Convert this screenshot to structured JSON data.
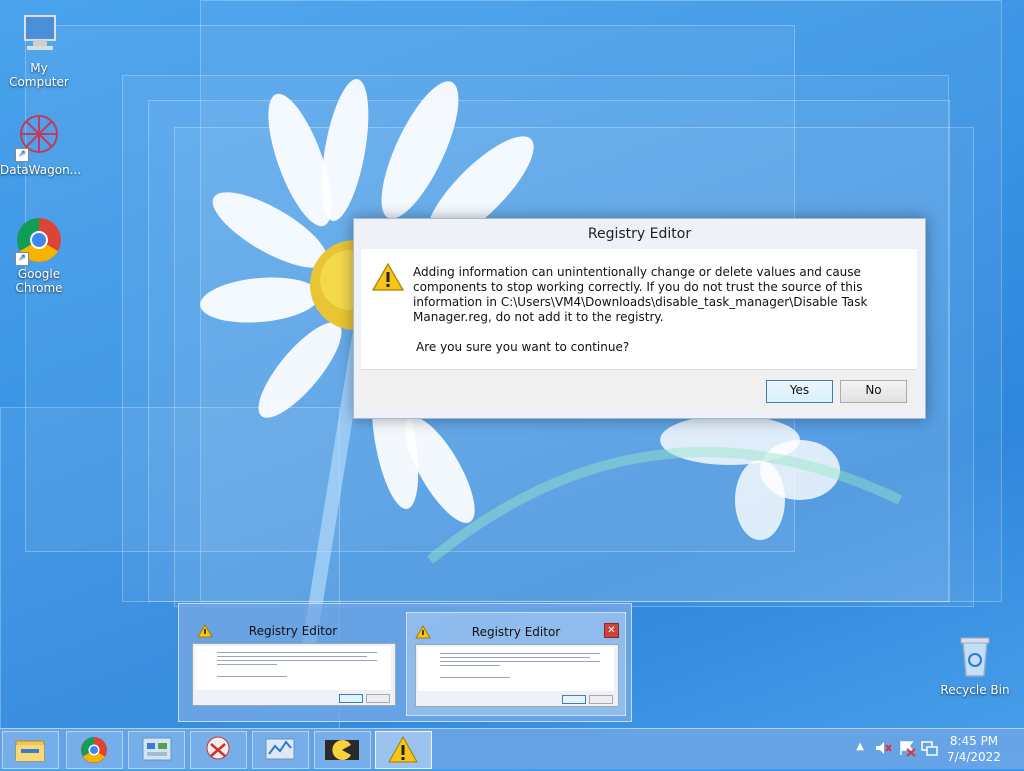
{
  "desktop": {
    "icons": [
      {
        "label": "My Computer",
        "icon": "computer-icon"
      },
      {
        "label": "DataWagon...",
        "icon": "datawagon-icon"
      },
      {
        "label": "Google Chrome",
        "icon": "chrome-icon"
      },
      {
        "label": "Recycle Bin",
        "icon": "recycle-bin-icon"
      }
    ]
  },
  "dialog": {
    "title": "Registry Editor",
    "message": "Adding information can unintentionally change or delete values and cause components to stop working correctly. If you do not trust the source of this information in C:\\Users\\VM4\\Downloads\\disable_task_manager\\Disable Task Manager.reg, do not add it to the registry.",
    "question": "Are you sure you want to continue?",
    "yes_label": "Yes",
    "no_label": "No",
    "icon": "warning-icon"
  },
  "thumbnails": [
    {
      "title": "Registry Editor"
    },
    {
      "title": "Registry Editor",
      "close": "✕"
    }
  ],
  "taskbar": {
    "apps": [
      "file-explorer-icon",
      "chrome-icon",
      "control-panel-icon",
      "snipping-icon",
      "performance-monitor-icon",
      "pacman-icon",
      "warning-icon"
    ],
    "clock_time": "8:45 PM",
    "clock_date": "7/4/2022"
  },
  "colors": {
    "accent": "#3c7fb1",
    "warning": "#f5c518"
  }
}
